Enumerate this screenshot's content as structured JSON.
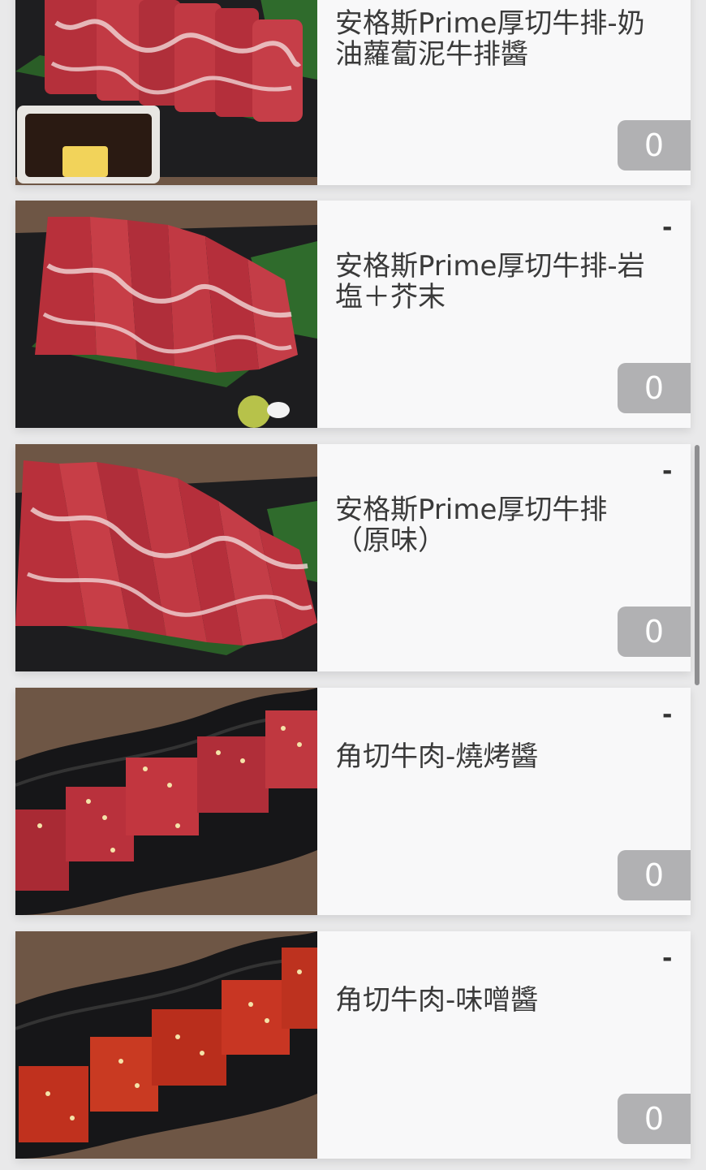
{
  "items": [
    {
      "name": "安格斯Prime厚切牛排-奶\n油蘿蔔泥牛排醬",
      "dash": "",
      "qty": "0",
      "image": "steak-butter-sauce"
    },
    {
      "name": "安格斯Prime厚切牛排-岩\n塩＋芥末",
      "dash": "-",
      "qty": "0",
      "image": "steak-salt-wasabi"
    },
    {
      "name": "安格斯Prime厚切牛排\n（原味）",
      "dash": "-",
      "qty": "0",
      "image": "steak-original"
    },
    {
      "name": "角切牛肉-燒烤醬",
      "dash": "-",
      "qty": "0",
      "image": "beef-cubes-bbq"
    },
    {
      "name": "角切牛肉-味噌醬",
      "dash": "-",
      "qty": "0",
      "image": "beef-cubes-miso"
    }
  ],
  "colors": {
    "qty_bg": "#b1b1b3",
    "card_bg": "#f8f8f9",
    "page_bg": "#e9e9ea"
  }
}
